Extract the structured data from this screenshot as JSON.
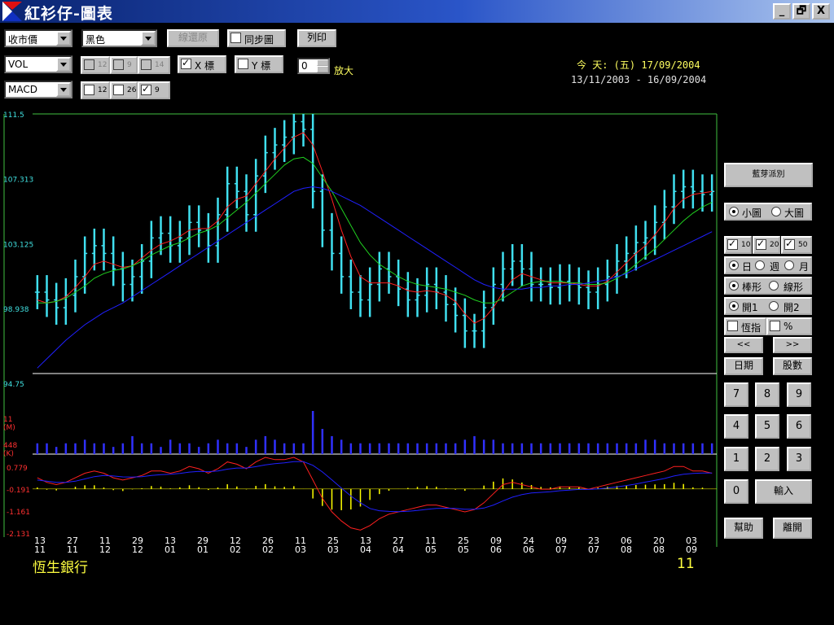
{
  "window": {
    "title": "紅衫仔-圖表",
    "controls": [
      "_",
      "🗗",
      "X"
    ]
  },
  "toolbar": {
    "price_select": "收市價",
    "color_select": "黑色",
    "reset_button": "線還原",
    "sync_label": "同步圖",
    "print_button": "列印",
    "indicator1_select": "VOL",
    "indicator2_select": "MACD",
    "vol_params": [
      "12",
      "9",
      "14"
    ],
    "macd_params": [
      "12",
      "26",
      "9"
    ],
    "x_label": "X 標",
    "y_label": "Y 標",
    "zoom_value": "0",
    "zoom_label": "放大"
  },
  "info": {
    "today": "今 天: (五) 17/09/2004",
    "range": "13/11/2003 - 16/09/2004"
  },
  "side": {
    "top_button": "藍芽派別",
    "small_chart": "小圖",
    "large_chart": "大圖",
    "ma_checks": [
      "10",
      "20",
      "50"
    ],
    "periods": [
      "日",
      "週",
      "月"
    ],
    "chart_types": [
      "棒形",
      "線形"
    ],
    "open_modes": [
      "開1",
      "開2"
    ],
    "index_label": "恆指",
    "percent_label": "%",
    "prev": "<<",
    "next": ">>",
    "date_button": "日期",
    "stock_button": "股數",
    "keys": [
      "7",
      "8",
      "9",
      "4",
      "5",
      "6",
      "1",
      "2",
      "3",
      "0"
    ],
    "enter": "輸入",
    "help": "幫助",
    "close": "離開"
  },
  "footer": {
    "stock_name": "恆生銀行",
    "stock_code": "11"
  },
  "colors": {
    "bars": "#40e0f0",
    "ma10": "#ff2020",
    "ma20": "#20d020",
    "ma50": "#2020ff",
    "vol": "#3030ff",
    "macd_hist": "#ffff00",
    "frame": "#40c040",
    "axis_label": "#40e0e0"
  },
  "chart_data": [
    {
      "type": "bar",
      "panel": "price",
      "ylim": [
        94.75,
        111.5
      ],
      "ytick_labels": [
        "111.5",
        "107.313",
        "103.125",
        "98.938",
        "94.75"
      ],
      "xtick_labels": [
        [
          "13",
          "11"
        ],
        [
          "27",
          "11"
        ],
        [
          "11",
          "12"
        ],
        [
          "29",
          "12"
        ],
        [
          "13",
          "01"
        ],
        [
          "29",
          "01"
        ],
        [
          "12",
          "02"
        ],
        [
          "26",
          "02"
        ],
        [
          "11",
          "03"
        ],
        [
          "25",
          "03"
        ],
        [
          "13",
          "04"
        ],
        [
          "27",
          "04"
        ],
        [
          "11",
          "05"
        ],
        [
          "25",
          "05"
        ],
        [
          "09",
          "06"
        ],
        [
          "24",
          "06"
        ],
        [
          "09",
          "07"
        ],
        [
          "23",
          "07"
        ],
        [
          "06",
          "08"
        ],
        [
          "20",
          "08"
        ],
        [
          "03",
          "09"
        ]
      ],
      "close": [
        100,
        99.5,
        99,
        99.8,
        101,
        102.5,
        103,
        102.5,
        101.5,
        100.5,
        101,
        102,
        103.5,
        103.8,
        103,
        103.5,
        104.5,
        104,
        103,
        105,
        107,
        106.5,
        105,
        107.5,
        109,
        109.5,
        110,
        111,
        110.5,
        106.5,
        104,
        102.5,
        101,
        100,
        99.5,
        100.5,
        101.5,
        101,
        100.2,
        99.5,
        99.8,
        100.5,
        100,
        99.2,
        98.5,
        97.5,
        97.5,
        99,
        100.5,
        101.5,
        102,
        101.5,
        100.5,
        100.5,
        100.3,
        100.7,
        100.5,
        100.3,
        100,
        100.5,
        101,
        102,
        102.5,
        103.2,
        103.5,
        104.5,
        105.5,
        106.5,
        106.8,
        106.5,
        106.3,
        106.5
      ],
      "series": [
        {
          "name": "10",
          "color": "#ff2020",
          "values": [
            99.5,
            99.3,
            99.4,
            99.7,
            100.3,
            101,
            101.8,
            102,
            101.8,
            101.6,
            101.7,
            102.2,
            102.7,
            103.1,
            103.3,
            103.6,
            104,
            104.1,
            104.1,
            104.6,
            105.5,
            106,
            106.2,
            107,
            107.8,
            108.6,
            109.3,
            110,
            110.3,
            109.5,
            107.8,
            106,
            104,
            102.3,
            101,
            100.6,
            100.6,
            100.6,
            100.4,
            100.1,
            100,
            100.1,
            100,
            99.8,
            99.4,
            98.6,
            98,
            98.3,
            99,
            100,
            100.8,
            101.2,
            101,
            100.8,
            100.6,
            100.6,
            100.6,
            100.5,
            100.4,
            100.4,
            100.7,
            101.3,
            101.9,
            102.5,
            103,
            103.7,
            104.5,
            105.4,
            106,
            106.3,
            106.4,
            106.5
          ]
        },
        {
          "name": "20",
          "color": "#20d020",
          "values": [
            99.3,
            99.3,
            99.4,
            99.6,
            100,
            100.4,
            100.9,
            101.2,
            101.4,
            101.5,
            101.7,
            102,
            102.4,
            102.7,
            103,
            103.2,
            103.5,
            103.8,
            104,
            104.3,
            104.8,
            105.3,
            105.8,
            106.4,
            107,
            107.6,
            108.2,
            108.6,
            108.7,
            108.3,
            107.4,
            106.5,
            105.4,
            104.3,
            103.2,
            102.4,
            101.8,
            101.4,
            101,
            100.7,
            100.5,
            100.4,
            100.3,
            100.2,
            100,
            99.8,
            99.5,
            99.3,
            99.3,
            99.6,
            100,
            100.4,
            100.6,
            100.7,
            100.7,
            100.7,
            100.6,
            100.6,
            100.5,
            100.5,
            100.6,
            100.9,
            101.3,
            101.8,
            102.3,
            102.8,
            103.4,
            104,
            104.6,
            105.1,
            105.5,
            105.8
          ]
        },
        {
          "name": "50",
          "color": "#2020ff",
          "values": [
            95.1,
            95.7,
            96.3,
            96.9,
            97.4,
            97.9,
            98.3,
            98.7,
            99,
            99.3,
            99.7,
            100.1,
            100.5,
            100.9,
            101.3,
            101.7,
            102.1,
            102.5,
            102.9,
            103.3,
            103.7,
            104.1,
            104.5,
            104.9,
            105.3,
            105.7,
            106.1,
            106.5,
            106.7,
            106.8,
            106.7,
            106.5,
            106.2,
            105.9,
            105.6,
            105.2,
            104.8,
            104.4,
            104,
            103.6,
            103.2,
            102.8,
            102.4,
            102,
            101.6,
            101.2,
            100.8,
            100.5,
            100.3,
            100.2,
            100.2,
            100.2,
            100.3,
            100.3,
            100.4,
            100.4,
            100.5,
            100.5,
            100.6,
            100.7,
            100.8,
            101,
            101.2,
            101.5,
            101.8,
            102.1,
            102.4,
            102.7,
            103,
            103.3,
            103.6,
            103.9
          ]
        }
      ]
    },
    {
      "type": "bar",
      "panel": "volume",
      "ytick_labels": [
        "11",
        "(M)",
        "448",
        "(K)"
      ],
      "values": [
        3,
        3,
        2,
        3,
        3,
        4,
        3,
        3,
        2,
        3,
        5,
        3,
        3,
        2,
        4,
        3,
        3,
        2,
        3,
        4,
        3,
        3,
        2,
        4,
        5,
        4,
        3,
        3,
        3,
        12,
        7,
        5,
        4,
        3,
        3,
        3,
        3,
        3,
        3,
        3,
        3,
        3,
        3,
        3,
        3,
        4,
        5,
        4,
        4,
        3,
        3,
        3,
        3,
        3,
        3,
        3,
        3,
        3,
        3,
        3,
        3,
        3,
        3,
        3,
        4,
        4,
        3,
        3,
        3,
        3,
        3,
        3
      ]
    },
    {
      "type": "line",
      "panel": "macd",
      "ylim": [
        -2.131,
        1.2
      ],
      "ytick_labels": [
        "0.779",
        "-0.191",
        "-1.161",
        "-2.131"
      ],
      "series": [
        {
          "name": "",
          "color": "#ff2020",
          "values": [
            0.3,
            0.1,
            0,
            0.1,
            0.3,
            0.5,
            0.6,
            0.5,
            0.3,
            0.2,
            0.3,
            0.4,
            0.6,
            0.6,
            0.5,
            0.6,
            0.8,
            0.7,
            0.5,
            0.7,
            1,
            0.9,
            0.7,
            1,
            1.2,
            1.1,
            1.1,
            1.2,
            1,
            0.2,
            -0.6,
            -1.2,
            -1.6,
            -1.9,
            -2,
            -1.8,
            -1.5,
            -1.3,
            -1.2,
            -1.1,
            -1,
            -0.9,
            -0.9,
            -1,
            -1.1,
            -1.2,
            -1.1,
            -0.8,
            -0.4,
            0,
            0.1,
            0,
            -0.1,
            -0.2,
            -0.2,
            -0.1,
            -0.1,
            -0.1,
            -0.2,
            -0.1,
            0,
            0.1,
            0.2,
            0.3,
            0.4,
            0.5,
            0.6,
            0.8,
            0.8,
            0.6,
            0.6,
            0.5
          ]
        },
        {
          "name": "",
          "color": "#2020ff",
          "values": [
            0.2,
            0.15,
            0.1,
            0.1,
            0.15,
            0.25,
            0.35,
            0.4,
            0.38,
            0.34,
            0.33,
            0.35,
            0.4,
            0.44,
            0.46,
            0.49,
            0.55,
            0.58,
            0.57,
            0.6,
            0.68,
            0.73,
            0.73,
            0.79,
            0.87,
            0.92,
            0.96,
            1.01,
            1.01,
            0.85,
            0.56,
            0.21,
            -0.15,
            -0.5,
            -0.8,
            -1.05,
            -1.15,
            -1.18,
            -1.19,
            -1.17,
            -1.14,
            -1.09,
            -1.05,
            -1.04,
            -1.05,
            -1.08,
            -1.08,
            -1.03,
            -0.9,
            -0.72,
            -0.55,
            -0.44,
            -0.37,
            -0.34,
            -0.31,
            -0.27,
            -0.24,
            -0.21,
            -0.21,
            -0.19,
            -0.15,
            -0.1,
            -0.04,
            0.03,
            0.11,
            0.19,
            0.27,
            0.38,
            0.46,
            0.49,
            0.51,
            0.51
          ]
        }
      ],
      "histogram": [
        0.1,
        -0.05,
        -0.1,
        0,
        0.15,
        0.25,
        0.25,
        0.1,
        -0.08,
        -0.14,
        -0.03,
        0.05,
        0.2,
        0.16,
        0.04,
        0.11,
        0.25,
        0.12,
        -0.07,
        0.1,
        0.32,
        0.17,
        -0.03,
        0.21,
        0.33,
        0.18,
        0.14,
        0.19,
        -0.01,
        -0.65,
        -1.16,
        -1.41,
        -1.45,
        -1.4,
        -1.2,
        -0.75,
        -0.35,
        -0.12,
        -0.01,
        0.07,
        0.14,
        0.19,
        0.15,
        0.04,
        -0.05,
        -0.12,
        -0.02,
        0.23,
        0.5,
        0.72,
        0.65,
        0.44,
        0.27,
        0.14,
        0.11,
        0.17,
        0.14,
        0.11,
        0.01,
        0.09,
        0.15,
        0.2,
        0.24,
        0.27,
        0.29,
        0.31,
        0.33,
        0.42,
        0.34,
        0.11,
        0.09,
        -0.01
      ]
    }
  ]
}
